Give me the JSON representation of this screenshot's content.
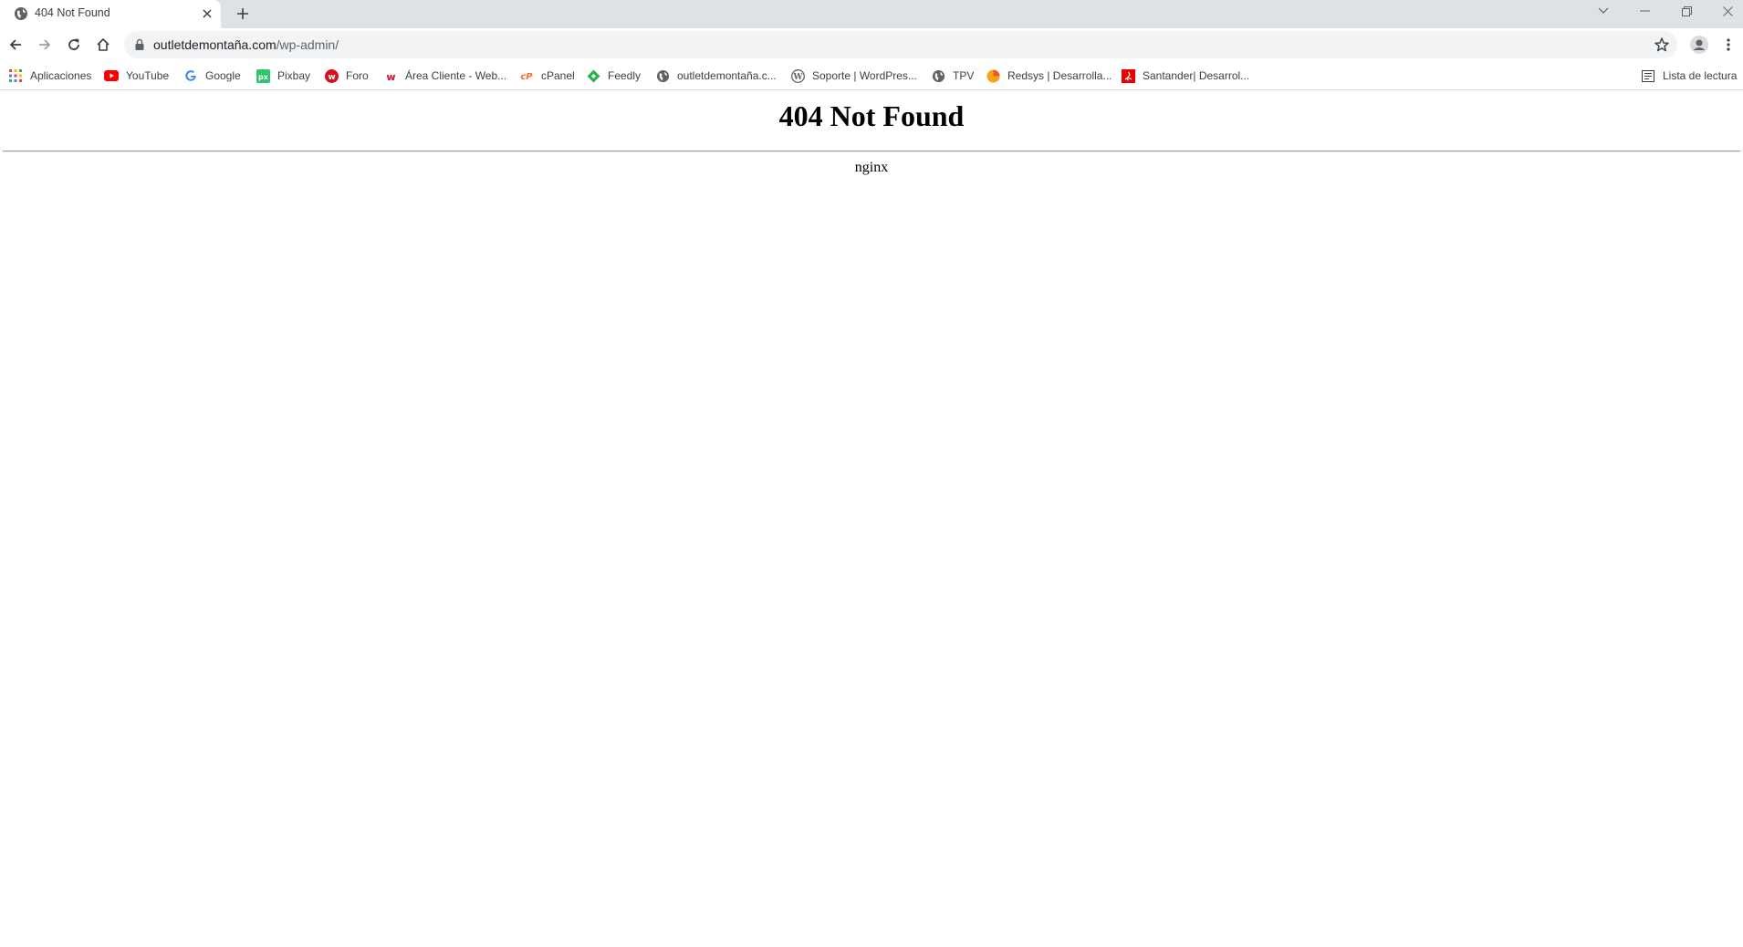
{
  "browser": {
    "tab": {
      "title": "404 Not Found",
      "favicon": "globe-icon"
    },
    "address_bar": {
      "host": "outletdemontaña.com",
      "path": "/wp-admin/"
    },
    "bookmarks": [
      {
        "label": "Aplicaciones",
        "icon": "apps-grid-icon"
      },
      {
        "label": "YouTube",
        "icon": "youtube-icon"
      },
      {
        "label": "Google",
        "icon": "google-icon"
      },
      {
        "label": "Pixbay",
        "icon": "pixbay-icon"
      },
      {
        "label": "Foro",
        "icon": "foro-icon"
      },
      {
        "label": "Área Cliente - Web...",
        "icon": "webempresa-icon"
      },
      {
        "label": "cPanel",
        "icon": "cpanel-icon"
      },
      {
        "label": "Feedly",
        "icon": "feedly-icon"
      },
      {
        "label": "outletdemontaña.c...",
        "icon": "globe-icon"
      },
      {
        "label": "Soporte | WordPres...",
        "icon": "wordpress-icon"
      },
      {
        "label": "TPV",
        "icon": "globe-icon"
      },
      {
        "label": "Redsys | Desarrolla...",
        "icon": "redsys-icon"
      },
      {
        "label": "Santander| Desarrol...",
        "icon": "santander-icon"
      }
    ],
    "reading_list": {
      "label": "Lista de lectura",
      "icon": "reading-list-icon"
    },
    "colors": {
      "tabstrip": "#dee1e6",
      "omnibox": "#f1f3f4",
      "youtube": "#ff0000",
      "pixbay": "#2ec66d",
      "foro": "#d4111e",
      "cpanel": "#ff6c2c",
      "feedly": "#2bb24c",
      "santander": "#ec0000"
    }
  },
  "page": {
    "heading": "404 Not Found",
    "server": "nginx"
  }
}
